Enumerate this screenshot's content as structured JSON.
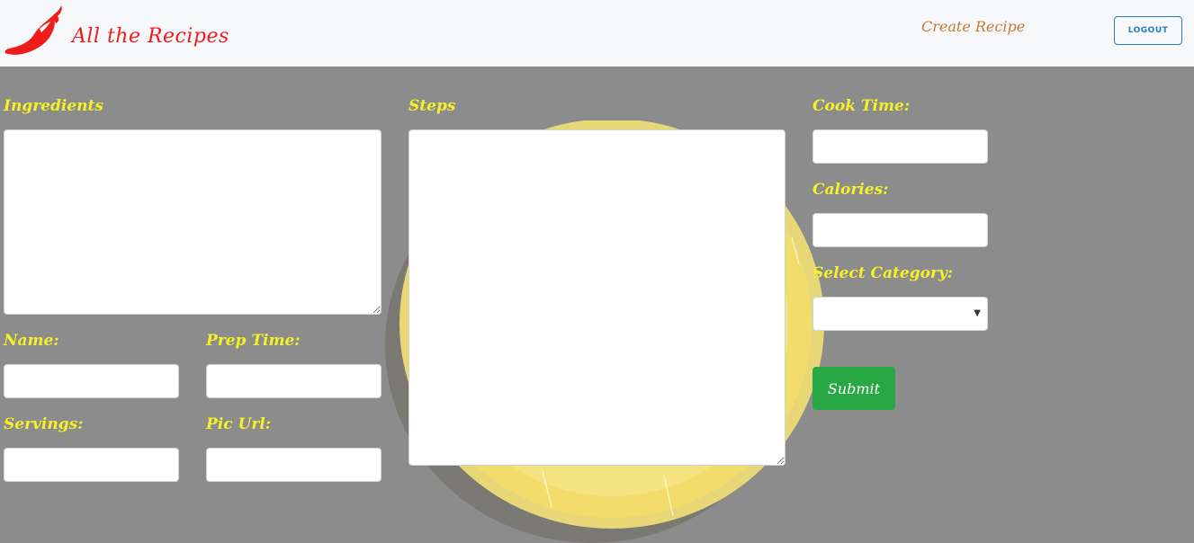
{
  "navbar": {
    "brand_name": "All the Recipes",
    "logo_icon": "chili-pepper-icon",
    "create_link": "Create Recipe",
    "logout_label": "LOGOUT"
  },
  "form": {
    "ingredients_label": "Ingredients",
    "steps_label": "Steps",
    "cook_time_label": "Cook Time:",
    "calories_label": "Calories:",
    "category_label": "Select Category:",
    "name_label": "Name:",
    "prep_time_label": "Prep Time:",
    "servings_label": "Servings:",
    "pic_url_label": "Pic Url:",
    "submit_label": "Submit",
    "category_selected": ""
  },
  "colors": {
    "background": "#8c8c8c",
    "navbar_bg": "#f7f8fa",
    "brand": "#ef1c1c",
    "label": "#f4f227",
    "create_link": "#c47c36",
    "logout": "#2c7ac0",
    "submit": "#27a844"
  }
}
